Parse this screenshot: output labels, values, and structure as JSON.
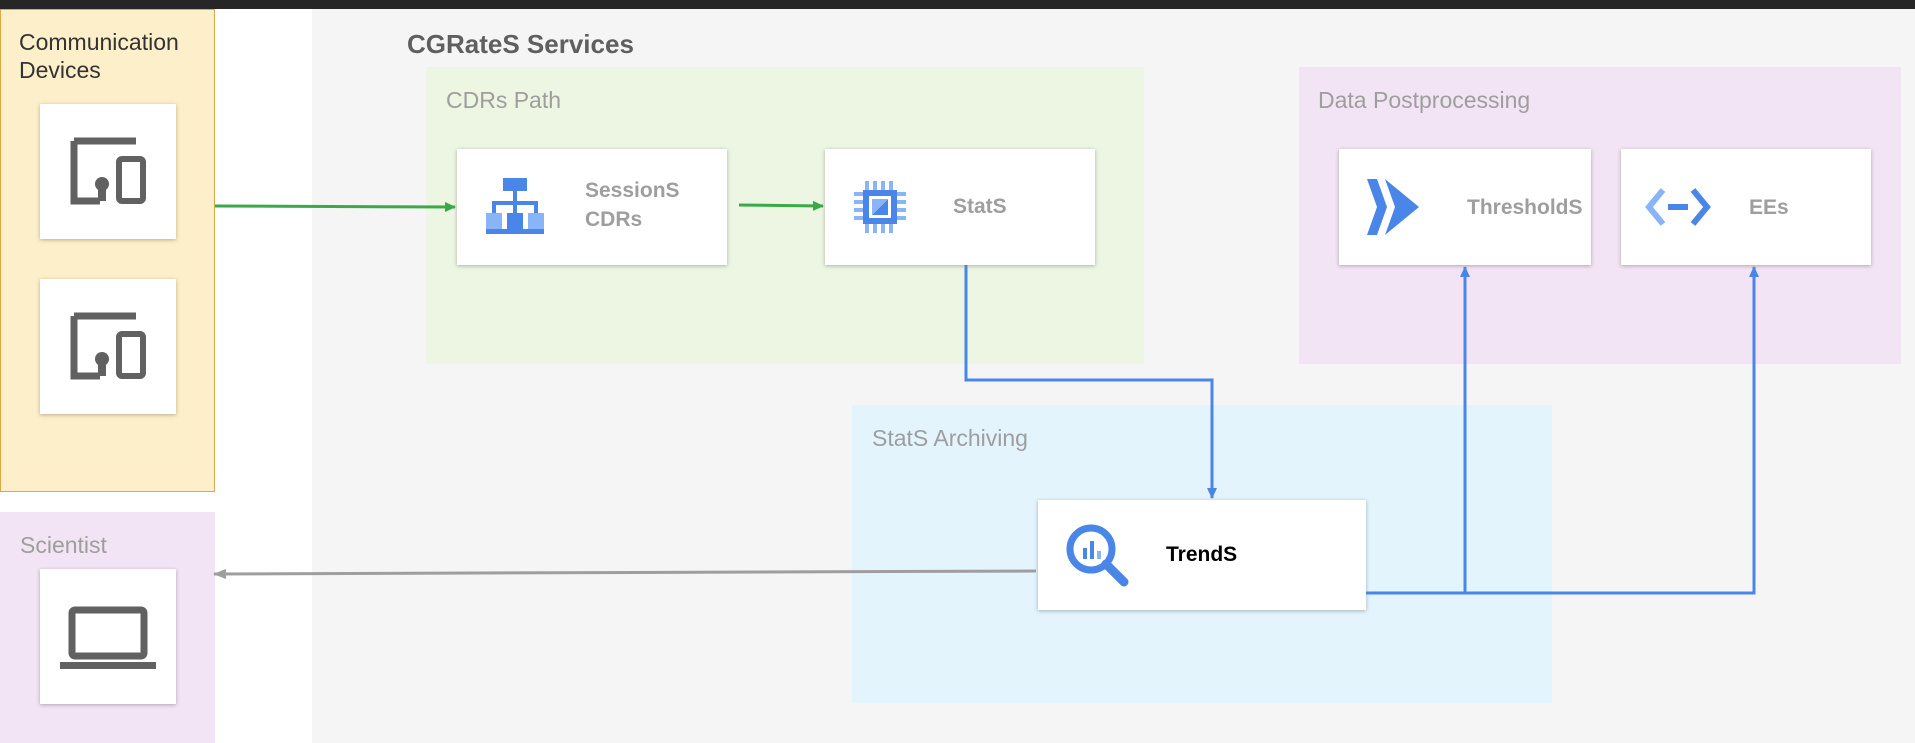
{
  "regions": {
    "devices": {
      "label_line1": "Communication",
      "label_line2": "Devices"
    },
    "services": {
      "label": "CGRateS Services"
    },
    "cdrs_path": {
      "label": "CDRs Path"
    },
    "data_postprocessing": {
      "label": "Data Postprocessing"
    },
    "stats_archiving": {
      "label": "StatS Archiving"
    },
    "scientist": {
      "label": "Scientist"
    }
  },
  "nodes": {
    "sessions": {
      "title": "SessionS",
      "subtitle": "CDRs",
      "icon": "hierarchy-icon"
    },
    "stats": {
      "title": "StatS",
      "icon": "cpu-chip-icon"
    },
    "thresholds": {
      "title": "ThresholdS",
      "icon": "chevron-arrow-icon"
    },
    "ees": {
      "title": "EEs",
      "icon": "code-brackets-icon"
    },
    "trends": {
      "title": "TrendS",
      "icon": "magnifier-chart-icon"
    }
  },
  "devices": [
    {
      "icon": "devices-icon"
    },
    {
      "icon": "devices-icon"
    }
  ],
  "scientist_device": {
    "icon": "laptop-icon"
  },
  "colors": {
    "green_arrow": "#3aaa48",
    "blue_arrow": "#4a86e8",
    "gray_arrow": "#9e9e9e",
    "devices_bg": "#fdefc9",
    "devices_border": "#d9a94a",
    "services_bg": "#f5f5f5",
    "cdrs_bg": "#edf5e3",
    "post_bg": "#f2e4f4",
    "archive_bg": "#e3f4fd",
    "scientist_bg": "#f2e4f4",
    "icon_blue": "#4a86e8"
  }
}
